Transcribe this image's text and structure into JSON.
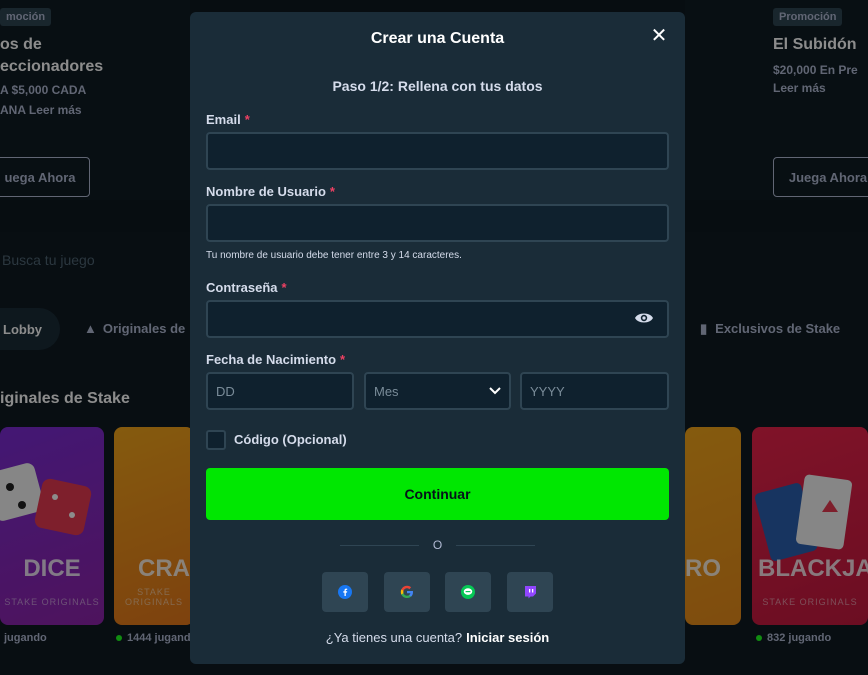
{
  "background": {
    "promo_left": {
      "badge": "moción",
      "title_line1": "os de",
      "title_line2": "eccionadores",
      "desc_line1": "A $5,000 CADA",
      "desc_line2": "ANA Leer más",
      "button": "uega Ahora"
    },
    "promo_right": {
      "badge": "Promoción",
      "title": "El Subidón",
      "desc_line1": "$20,000 En Pre",
      "desc_line2": "Leer más",
      "button": "Juega Ahora"
    },
    "search_placeholder": "Busca tu juego",
    "tabs": {
      "lobby": "Lobby",
      "originals": "Originales de",
      "exclusives": "Exclusivos de Stake"
    },
    "section_title": "iginales de Stake",
    "cards": {
      "dice": {
        "name": "DICE",
        "sub": "STAKE ORIGINALS"
      },
      "crash": {
        "name": "CRA",
        "sub": "STAKE ORIGINALS"
      },
      "mid": {
        "name": "RO",
        "sub": ""
      },
      "blackjack": {
        "name": "BLACKJAC",
        "sub": "STAKE ORIGINALS"
      }
    },
    "playing": {
      "dice": "jugando",
      "crash": "1444 jugando",
      "blackjack": "832 jugando"
    }
  },
  "modal": {
    "title": "Crear una Cuenta",
    "step": "Paso 1/2: Rellena con tus datos",
    "email_label": "Email",
    "username_label": "Nombre de Usuario",
    "username_hint": "Tu nombre de usuario debe tener entre 3 y 14 caracteres.",
    "password_label": "Contraseña",
    "dob_label": "Fecha de Nacimiento",
    "required_mark": "*",
    "dob_day_placeholder": "DD",
    "dob_month_placeholder": "Mes",
    "dob_year_placeholder": "YYYY",
    "code_label": "Código (Opcional)",
    "continue_label": "Continuar",
    "or_label": "O",
    "footer_text": "¿Ya tienes una cuenta?",
    "login_link": "Iniciar sesión",
    "social": [
      "facebook",
      "google",
      "line",
      "twitch"
    ]
  },
  "colors": {
    "accent_green": "#00e701",
    "modal_bg": "#1a2c38",
    "input_bg": "#0f212e",
    "required": "#ed4163"
  }
}
